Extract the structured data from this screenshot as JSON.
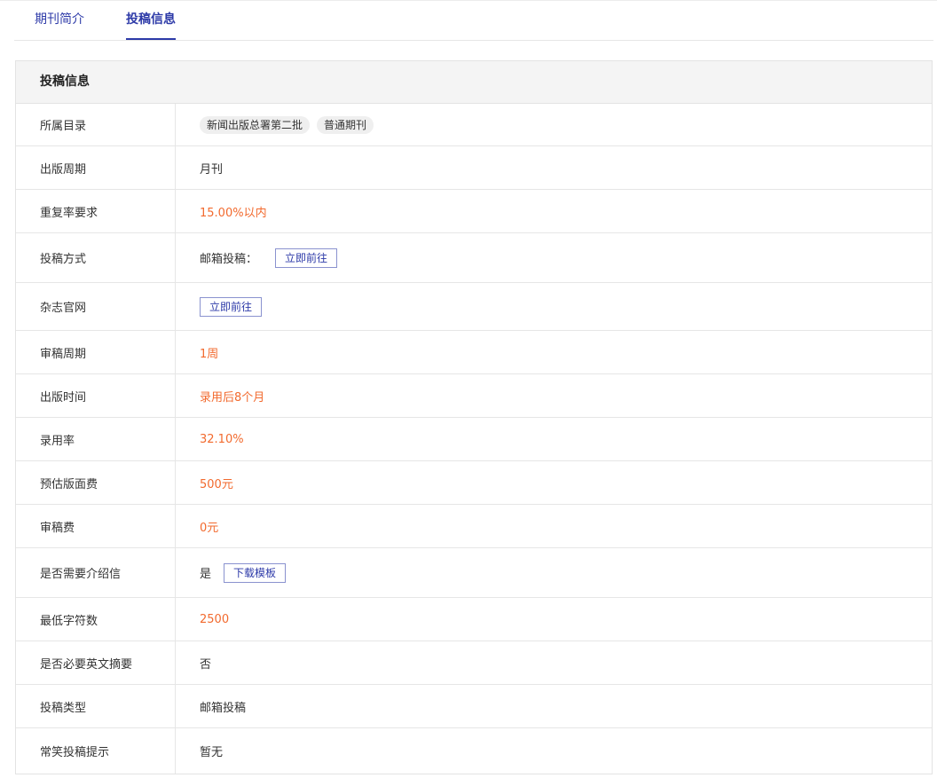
{
  "tabs": [
    {
      "label": "期刊简介",
      "active": false
    },
    {
      "label": "投稿信息",
      "active": true
    }
  ],
  "panel": {
    "title": "投稿信息",
    "rows": {
      "catalog": {
        "label": "所属目录",
        "tags": [
          "新闻出版总署第二批",
          "普通期刊"
        ]
      },
      "cycle": {
        "label": "出版周期",
        "value": "月刊"
      },
      "dup": {
        "label": "重复率要求",
        "value": "15.00%以内"
      },
      "method": {
        "label": "投稿方式",
        "value": "邮箱投稿：",
        "button": "立即前往"
      },
      "site": {
        "label": "杂志官网",
        "button": "立即前往"
      },
      "review_cycle": {
        "label": "审稿周期",
        "value": "1周"
      },
      "pub_time": {
        "label": "出版时间",
        "value": "录用后8个月"
      },
      "accept_rate": {
        "label": "录用率",
        "value": "32.10%"
      },
      "page_fee": {
        "label": "预估版面费",
        "value": "500元"
      },
      "review_fee": {
        "label": "审稿费",
        "value": "0元"
      },
      "letter": {
        "label": "是否需要介绍信",
        "value": "是",
        "button": "下载模板"
      },
      "min_chars": {
        "label": "最低字符数",
        "value": "2500"
      },
      "en_abstract": {
        "label": "是否必要英文摘要",
        "value": "否"
      },
      "sub_type": {
        "label": "投稿类型",
        "value": "邮箱投稿"
      },
      "tips": {
        "label": "常笑投稿提示",
        "value": "暂无"
      }
    }
  },
  "colors": {
    "accent": "#2d3aa8",
    "highlight": "#f26a2e",
    "header_bg": "#f4f4f4",
    "border": "#e6e6e6"
  }
}
